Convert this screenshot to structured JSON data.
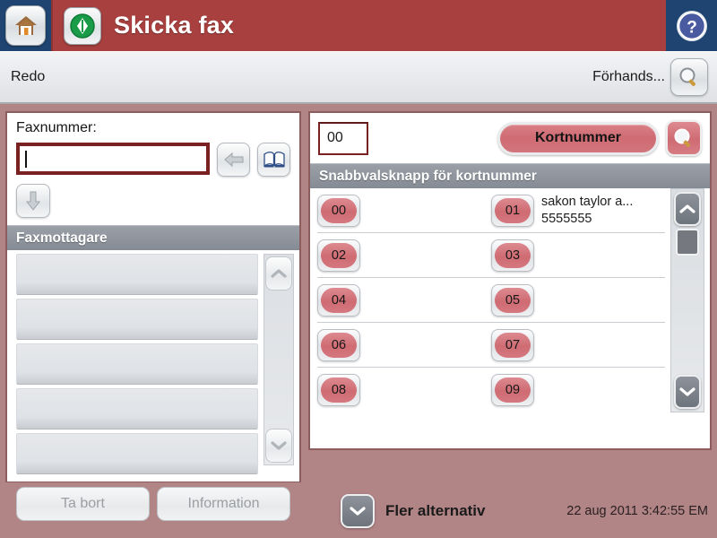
{
  "header": {
    "home_icon": "home-icon",
    "app_icon": "green-start-icon",
    "title": "Skicka fax",
    "help_icon": "help-icon"
  },
  "status": {
    "state": "Redo",
    "preview_label": "Förhands...",
    "preview_icon": "magnifier-icon"
  },
  "left_panel": {
    "fax_number_label": "Faxnummer:",
    "fax_number_value": "",
    "fax_number_placeholder": "",
    "back_icon": "back-arrow-icon",
    "addressbook_icon": "address-book-icon",
    "add_icon": "down-arrow-icon",
    "recipients_header": "Faxmottagare",
    "recipients": [
      "",
      "",
      "",
      "",
      ""
    ],
    "scroll_up_icon": "chevron-up-icon",
    "scroll_down_icon": "chevron-down-icon",
    "delete_button": "Ta bort",
    "info_button": "Information"
  },
  "right_panel": {
    "code_value": "00",
    "code_placeholder": "",
    "speed_dial_button": "Kortnummer",
    "search_icon": "magnifier-red-icon",
    "section_header": "Snabbvalsknapp för kortnummer",
    "entries": [
      {
        "code": "00",
        "name": "",
        "number": ""
      },
      {
        "code": "01",
        "name": "sakon taylor a...",
        "number": "5555555"
      },
      {
        "code": "02",
        "name": "",
        "number": ""
      },
      {
        "code": "03",
        "name": "",
        "number": ""
      },
      {
        "code": "04",
        "name": "",
        "number": ""
      },
      {
        "code": "05",
        "name": "",
        "number": ""
      },
      {
        "code": "06",
        "name": "",
        "number": ""
      },
      {
        "code": "07",
        "name": "",
        "number": ""
      },
      {
        "code": "08",
        "name": "",
        "number": ""
      },
      {
        "code": "09",
        "name": "",
        "number": ""
      }
    ],
    "scroll_up_icon": "chevron-up-icon",
    "scroll_down_icon": "chevron-down-icon"
  },
  "footer": {
    "more_options_icon": "chevron-down-icon",
    "more_options_label": "Fler alternativ",
    "timestamp": "22 aug 2011 3:42:55 EM"
  },
  "colors": {
    "title_bar": "#a7403f",
    "chrome_blue": "#1f4472",
    "page_background": "#b18486",
    "accent_red": "#cf6b73",
    "input_border": "#7a2121"
  }
}
